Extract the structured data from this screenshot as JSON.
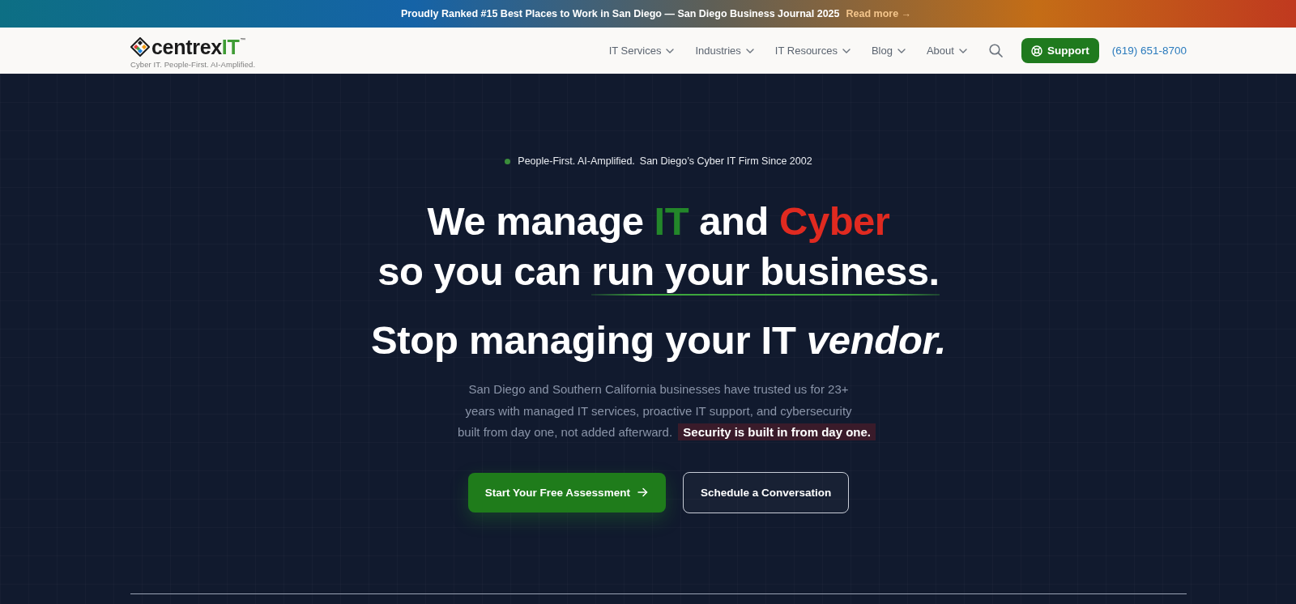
{
  "announcement_bar": {
    "text": "Proudly Ranked #15 Best Places to Work in San Diego — San Diego Business Journal 2025",
    "link": "Read more →"
  },
  "header": {
    "logo": {
      "wordmark": [
        {
          "text": "centrex",
          "color": "#1b1b1b"
        },
        {
          "text": "IT",
          "color": "#3f9c35"
        }
      ],
      "trademark": "™",
      "tagline": "Cyber IT. People-First. AI-Amplified."
    },
    "nav": [
      {
        "label": "IT Services"
      },
      {
        "label": "Industries"
      },
      {
        "label": "IT Resources"
      },
      {
        "label": "Blog"
      },
      {
        "label": "About"
      }
    ],
    "support_button": {
      "label": "Support"
    },
    "phone": "(619) 651-8700"
  },
  "hero": {
    "badge": [
      "People-First. AI-Amplified.",
      "San Diego’s Cyber IT Firm Since 2002"
    ],
    "headline_lines": [
      [
        {
          "text": "We manage ",
          "color": "#ffffff",
          "underlined": false
        },
        {
          "text": "IT",
          "color": "#23872a",
          "underlined": false
        },
        {
          "text": " and ",
          "color": "#ffffff",
          "underlined": false
        },
        {
          "text": "Cyber",
          "color": "#e02a20",
          "underlined": false
        }
      ],
      [
        {
          "text": "so you can ",
          "color": "#ffffff",
          "underlined": false
        },
        {
          "text": "run your business.",
          "color": "#ffffff",
          "underlined": true
        }
      ]
    ],
    "subheadline": "Stop managing your IT *vendor.*",
    "text": "San Diego and Southern California businesses have trusted us for 23+ years with managed IT services, proactive IT support, and cybersecurity built from day one, not added afterward. **Security is built in from day one.**",
    "buttons": [
      {
        "label": "Start Your Free Assessment",
        "kind": "primary"
      },
      {
        "label": "Schedule a Conversation",
        "kind": "secondary"
      }
    ]
  }
}
